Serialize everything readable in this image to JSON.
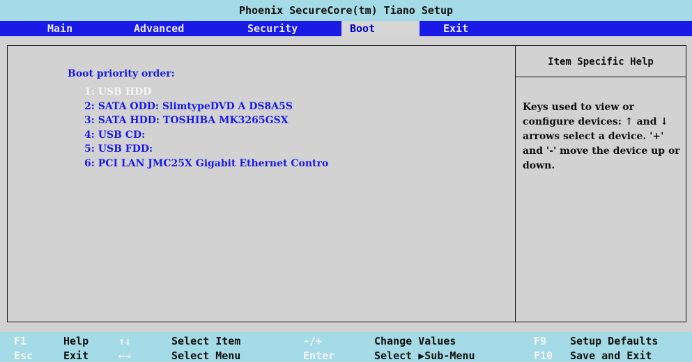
{
  "title": "Phoenix SecureCore(tm) Tiano Setup",
  "menu": {
    "main": "Main",
    "advanced": "Advanced",
    "security": "Security",
    "boot": "Boot",
    "exit": "Exit",
    "active": "Boot"
  },
  "boot": {
    "heading": "Boot priority order:",
    "items": [
      "1: USB HDD",
      "2: SATA ODD: SlimtypeDVD A DS8A5S",
      "3: SATA HDD: TOSHIBA MK3265GSX",
      "4: USB CD:",
      "5: USB FDD:",
      "6: PCI LAN JMC25X Gigabit Ethernet Contro"
    ],
    "selected_index": 0
  },
  "help": {
    "title": "Item Specific Help",
    "text": "Keys used to view or configure devices: ↑ and ↓ arrows select a device. '+' and '-' move the device up or down."
  },
  "footer": {
    "row1": {
      "k1": "F1",
      "d1": "Help",
      "k2": "↑↓",
      "d2": "Select Item",
      "k3": "-/+",
      "d3": "Change Values",
      "k4": "F9",
      "d4": "Setup Defaults"
    },
    "row2": {
      "k1": "Esc",
      "d1": "Exit",
      "k2": "←→",
      "d2": "Select Menu",
      "k3": "Enter",
      "d3": "Select ▶Sub-Menu",
      "k4": "F10",
      "d4": "Save and Exit"
    }
  },
  "colors": {
    "title_bg": "#a5dbe6",
    "menu_bg": "#1a1ae6",
    "body_bg": "#d2d2d2",
    "item_text": "#1a1ae6",
    "selected_text": "#f4f4f4"
  }
}
